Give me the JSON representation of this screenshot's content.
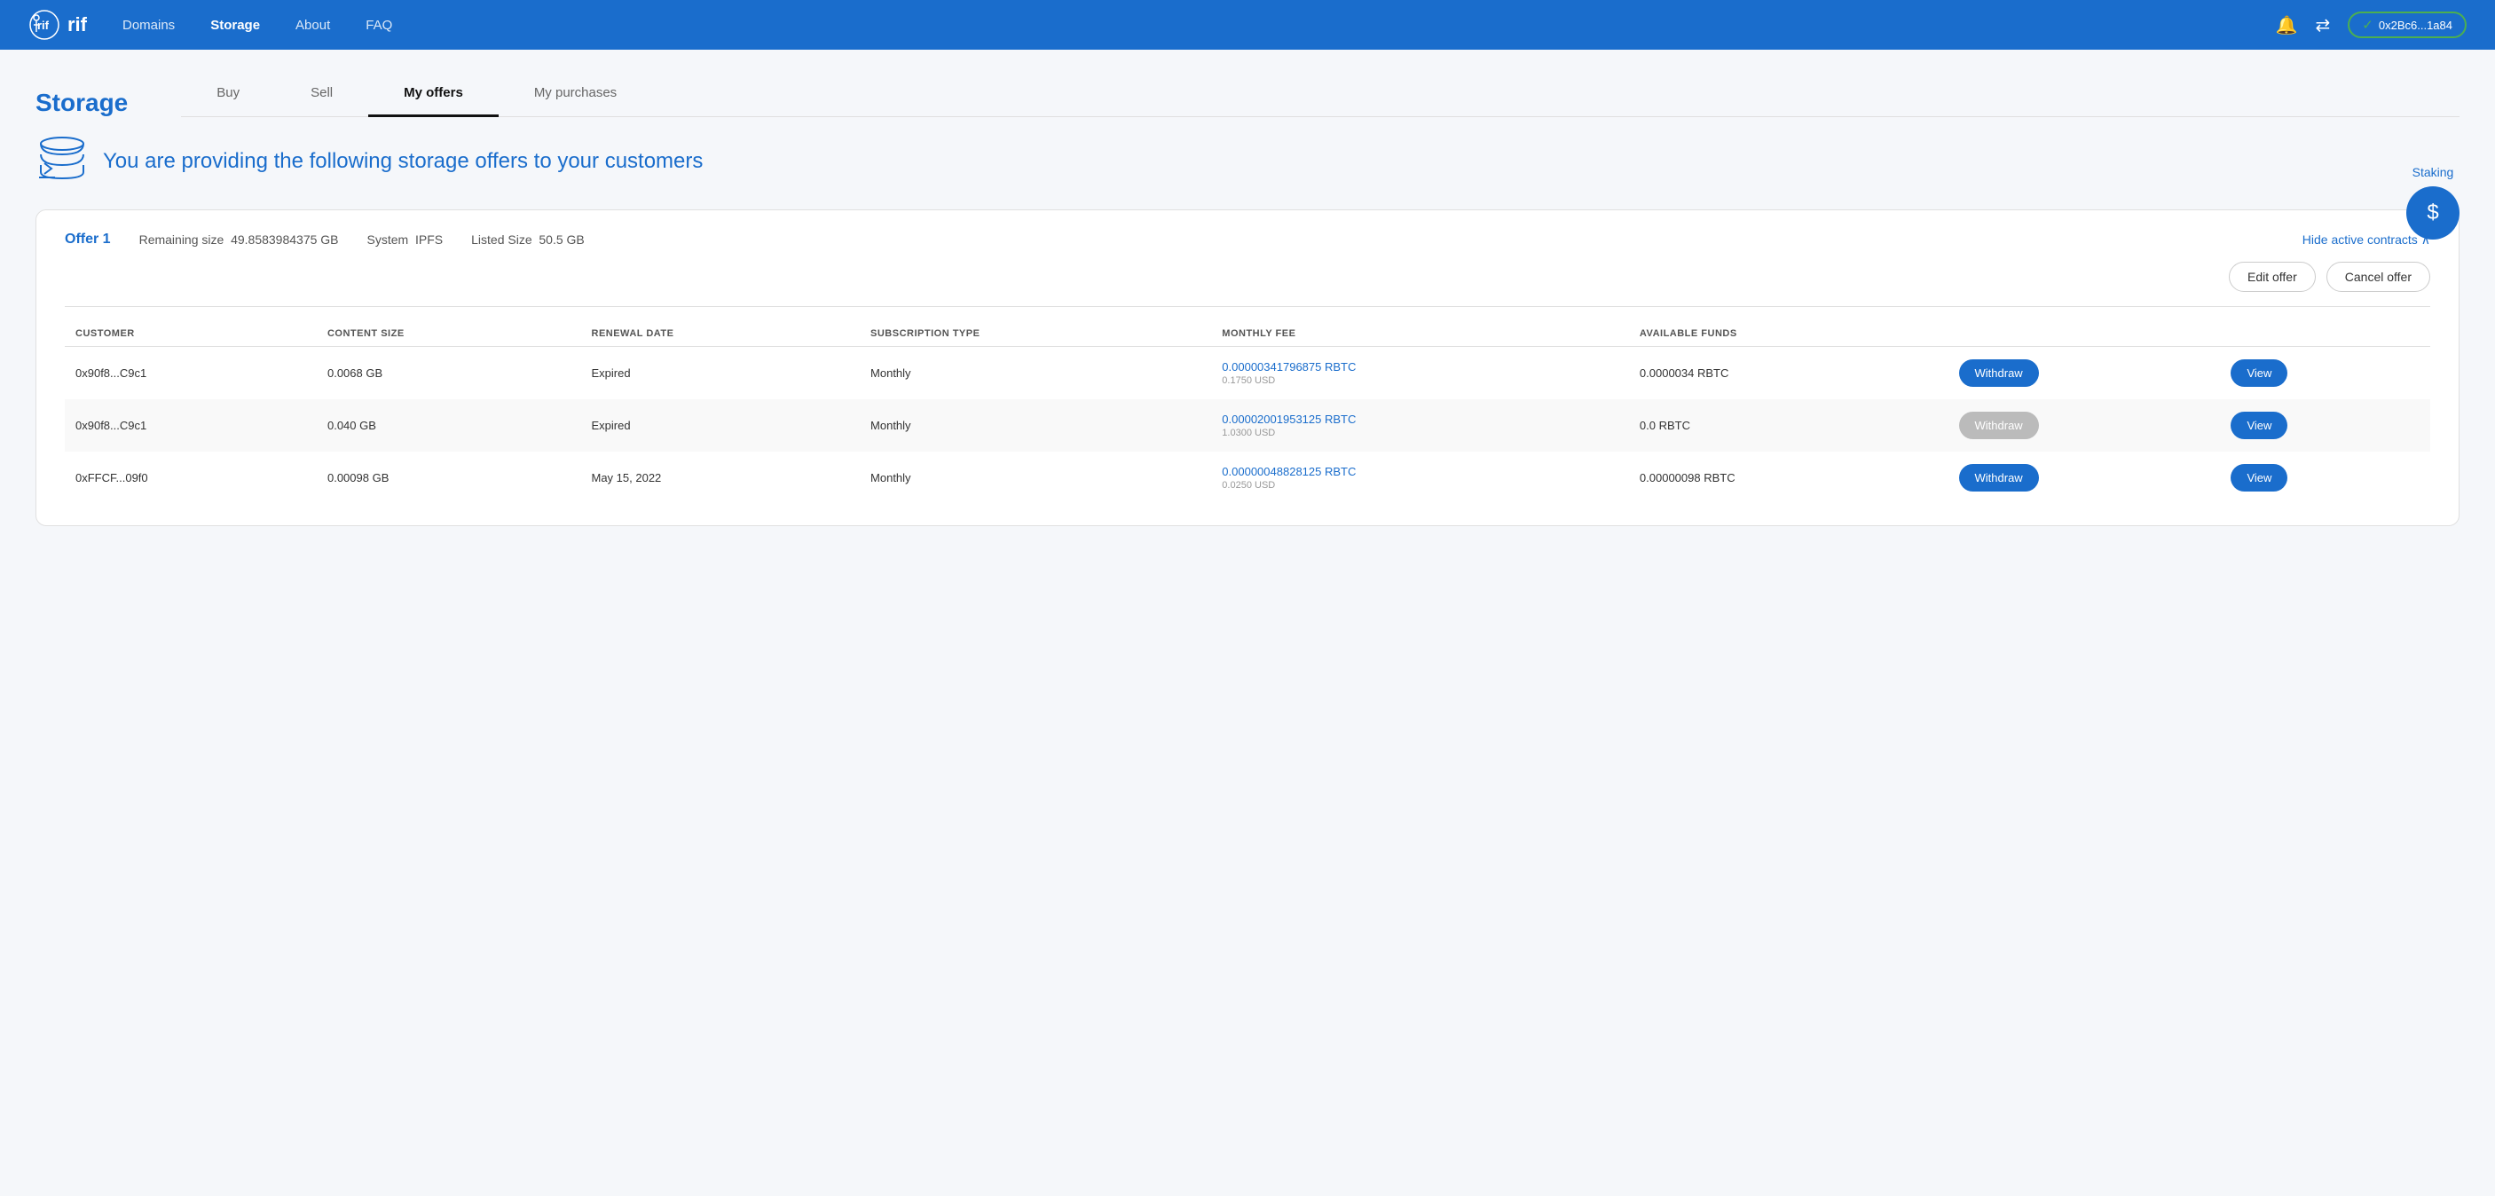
{
  "navbar": {
    "logo": "rif",
    "links": [
      {
        "label": "Domains",
        "active": false
      },
      {
        "label": "Storage",
        "active": true
      },
      {
        "label": "About",
        "active": false
      },
      {
        "label": "FAQ",
        "active": false
      }
    ],
    "wallet": "0x2Bc6...1a84"
  },
  "page": {
    "title": "Storage",
    "tabs": [
      {
        "label": "Buy",
        "active": false
      },
      {
        "label": "Sell",
        "active": false
      },
      {
        "label": "My offers",
        "active": true
      },
      {
        "label": "My purchases",
        "active": false
      }
    ]
  },
  "staking": {
    "label": "Staking",
    "icon": "$"
  },
  "hero": {
    "text": "You are providing the following storage offers to your customers"
  },
  "offer": {
    "name": "Offer 1",
    "remaining_size_label": "Remaining size",
    "remaining_size_value": "49.8583984375 GB",
    "system_label": "System",
    "system_value": "IPFS",
    "listed_size_label": "Listed Size",
    "listed_size_value": "50.5 GB",
    "hide_contracts": "Hide active contracts",
    "edit_btn": "Edit offer",
    "cancel_btn": "Cancel offer"
  },
  "table": {
    "headers": [
      {
        "label": "CUSTOMER"
      },
      {
        "label": "CONTENT SIZE"
      },
      {
        "label": "RENEWAL DATE"
      },
      {
        "label": "SUBSCRIPTION TYPE"
      },
      {
        "label": "MONTHLY FEE"
      },
      {
        "label": "AVAILABLE FUNDS"
      },
      {
        "label": ""
      },
      {
        "label": ""
      }
    ],
    "rows": [
      {
        "customer": "0x90f8...C9c1",
        "content_size": "0.0068 GB",
        "renewal_date": "Expired",
        "subscription_type": "Monthly",
        "monthly_fee_rbtc": "0.00000341796875 RBTC",
        "monthly_fee_usd": "0.1750 USD",
        "available_funds": "0.0000034 RBTC",
        "withdraw_enabled": true,
        "withdraw_label": "Withdraw",
        "view_label": "View"
      },
      {
        "customer": "0x90f8...C9c1",
        "content_size": "0.040 GB",
        "renewal_date": "Expired",
        "subscription_type": "Monthly",
        "monthly_fee_rbtc": "0.00002001953125 RBTC",
        "monthly_fee_usd": "1.0300 USD",
        "available_funds": "0.0 RBTC",
        "withdraw_enabled": false,
        "withdraw_label": "Withdraw",
        "view_label": "View"
      },
      {
        "customer": "0xFFCF...09f0",
        "content_size": "0.00098 GB",
        "renewal_date": "May 15, 2022",
        "subscription_type": "Monthly",
        "monthly_fee_rbtc": "0.00000048828125 RBTC",
        "monthly_fee_usd": "0.0250 USD",
        "available_funds": "0.00000098 RBTC",
        "withdraw_enabled": true,
        "withdraw_label": "Withdraw",
        "view_label": "View"
      }
    ]
  }
}
